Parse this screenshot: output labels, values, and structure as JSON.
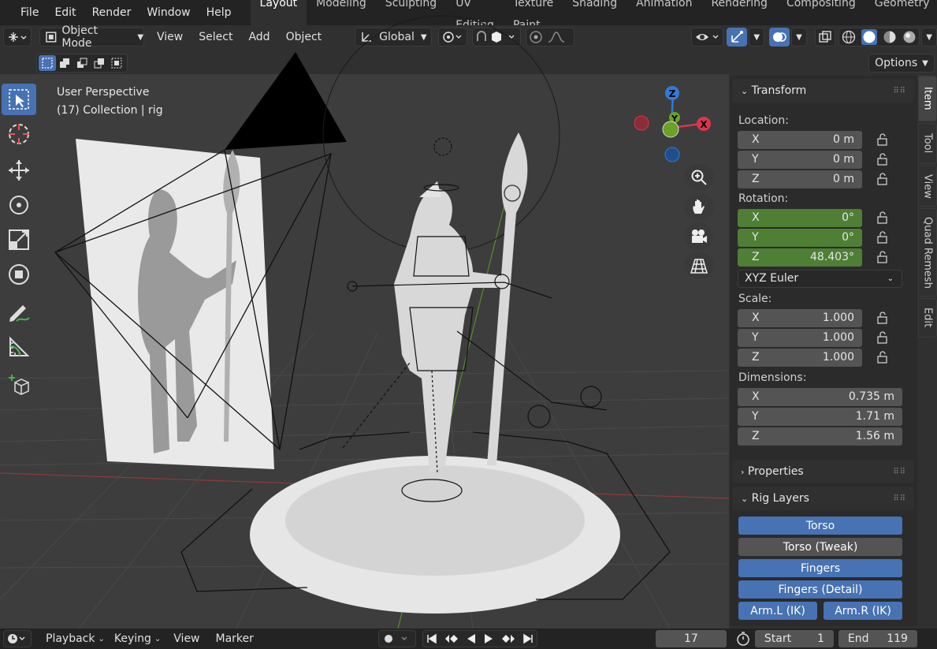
{
  "menu": [
    "File",
    "Edit",
    "Render",
    "Window",
    "Help"
  ],
  "workspaces": [
    "Layout",
    "Modeling",
    "Sculpting",
    "UV Editing",
    "Texture Paint",
    "Shading",
    "Animation",
    "Rendering",
    "Compositing",
    "Geometry"
  ],
  "header": {
    "mode": "Object Mode",
    "view": "View",
    "select": "Select",
    "add": "Add",
    "object": "Object",
    "orientation": "Global",
    "options": "Options"
  },
  "viewport": {
    "title": "User Perspective",
    "collection": "(17) Collection | rig"
  },
  "gizmo": {
    "z": "Z",
    "y": "Y",
    "x": "X"
  },
  "transform": {
    "title": "Transform",
    "location_label": "Location:",
    "location": [
      {
        "axis": "X",
        "value": "0 m"
      },
      {
        "axis": "Y",
        "value": "0 m"
      },
      {
        "axis": "Z",
        "value": "0 m"
      }
    ],
    "rotation_label": "Rotation:",
    "rotation": [
      {
        "axis": "X",
        "value": "0°"
      },
      {
        "axis": "Y",
        "value": "0°"
      },
      {
        "axis": "Z",
        "value": "48.403°"
      }
    ],
    "rotation_mode": "XYZ Euler",
    "scale_label": "Scale:",
    "scale": [
      {
        "axis": "X",
        "value": "1.000"
      },
      {
        "axis": "Y",
        "value": "1.000"
      },
      {
        "axis": "Z",
        "value": "1.000"
      }
    ],
    "dimensions_label": "Dimensions:",
    "dimensions": [
      {
        "axis": "X",
        "value": "0.735 m"
      },
      {
        "axis": "Y",
        "value": "1.71 m"
      },
      {
        "axis": "Z",
        "value": "1.56 m"
      }
    ]
  },
  "properties": {
    "title": "Properties"
  },
  "rig_layers": {
    "title": "Rig Layers",
    "torso": "Torso",
    "torso_tweak": "Torso (Tweak)",
    "fingers": "Fingers",
    "fingers_detail": "Fingers (Detail)",
    "arm_l": "Arm.L (IK)",
    "arm_r": "Arm.R (IK)"
  },
  "side_tabs": [
    "Item",
    "Tool",
    "View",
    "Quad Remesh",
    "Edit"
  ],
  "timeline": {
    "playback": "Playback",
    "keying": "Keying",
    "view": "View",
    "marker": "Marker",
    "current_frame": "17",
    "start_label": "Start",
    "start": "1",
    "end_label": "End",
    "end": "119"
  },
  "colors": {
    "accent": "#4772b3",
    "animated": "#4e7f35",
    "x_axis": "#d9364a",
    "y_axis": "#6ba126",
    "z_axis": "#2f7bd8"
  }
}
